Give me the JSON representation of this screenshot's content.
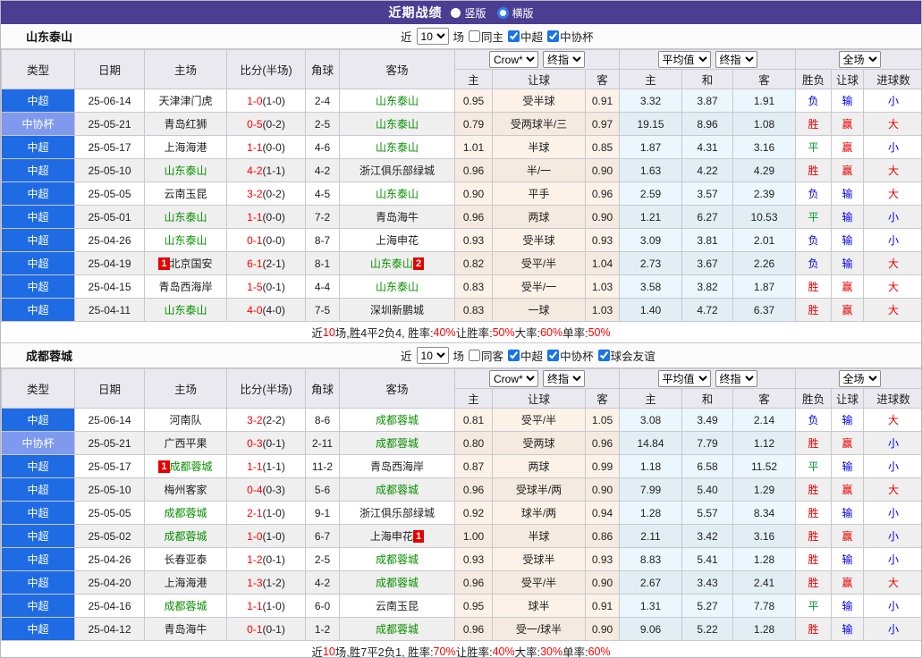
{
  "colors": {
    "header_purple": "#4b3e92",
    "type_csl_blue": "#1e6be4",
    "type_cup_blue": "#7e99ee",
    "team_green": "#089000",
    "score_red": "#ff0000",
    "win_red": "#e60000",
    "lose_blue": "#0000e6",
    "draw_green": "#009933"
  },
  "result_colors": {
    "胜": "#e60000",
    "平": "#009933",
    "负": "#0000e6",
    "赢": "#e60000",
    "输": "#0000e6",
    "大": "#e60000",
    "小": "#0000e6"
  },
  "type_colors": {
    "中超": "#1e6be4",
    "中协杯": "#7e99ee"
  },
  "topbar": {
    "title": "近期战绩",
    "radios": [
      {
        "label": "竖版",
        "selected": false
      },
      {
        "label": "横版",
        "selected": true
      }
    ]
  },
  "columns": {
    "main": [
      "类型",
      "日期",
      "主场",
      "比分(半场)",
      "角球",
      "客场"
    ],
    "sub": [
      "主",
      "让球",
      "客",
      "主",
      "和",
      "客",
      "胜负",
      "让球",
      "进球数"
    ]
  },
  "header_selects": {
    "crow": "Crow*",
    "crow_final": "终指",
    "avg": "平均值",
    "avg_final": "终指",
    "fullmatch": "全场"
  },
  "sections": [
    {
      "team": "山东泰山",
      "filter": {
        "near_label": "近",
        "count_value": "10",
        "games_label": "场",
        "checkboxes": [
          {
            "label": "同主",
            "checked": false
          },
          {
            "label": "中超",
            "checked": true
          },
          {
            "label": "中协杯",
            "checked": true
          }
        ]
      },
      "rows": [
        {
          "type": "中超",
          "date": "25-06-14",
          "home": {
            "name": "天津津门虎",
            "green": false
          },
          "ft": "1-0",
          "ht": "(1-0)",
          "corner": "2-4",
          "away": {
            "name": "山东泰山",
            "green": true
          },
          "odds": [
            "0.95",
            "受半球",
            "0.91"
          ],
          "avg": [
            "3.32",
            "3.87",
            "1.91"
          ],
          "res": [
            "负",
            "输",
            "小"
          ]
        },
        {
          "type": "中协杯",
          "date": "25-05-21",
          "home": {
            "name": "青岛红狮",
            "green": false
          },
          "ft": "0-5",
          "ht": "(0-2)",
          "corner": "2-5",
          "away": {
            "name": "山东泰山",
            "green": true
          },
          "odds": [
            "0.79",
            "受两球半/三",
            "0.97"
          ],
          "avg": [
            "19.15",
            "8.96",
            "1.08"
          ],
          "res": [
            "胜",
            "赢",
            "大"
          ]
        },
        {
          "type": "中超",
          "date": "25-05-17",
          "home": {
            "name": "上海海港",
            "green": false
          },
          "ft": "1-1",
          "ht": "(0-0)",
          "corner": "4-6",
          "away": {
            "name": "山东泰山",
            "green": true
          },
          "odds": [
            "1.01",
            "半球",
            "0.85"
          ],
          "avg": [
            "1.87",
            "4.31",
            "3.16"
          ],
          "res": [
            "平",
            "赢",
            "小"
          ]
        },
        {
          "type": "中超",
          "date": "25-05-10",
          "home": {
            "name": "山东泰山",
            "green": true
          },
          "ft": "4-2",
          "ht": "(1-1)",
          "corner": "4-2",
          "away": {
            "name": "浙江俱乐部绿城",
            "green": false
          },
          "odds": [
            "0.96",
            "半/一",
            "0.90"
          ],
          "avg": [
            "1.63",
            "4.22",
            "4.29"
          ],
          "res": [
            "胜",
            "赢",
            "大"
          ]
        },
        {
          "type": "中超",
          "date": "25-05-05",
          "home": {
            "name": "云南玉昆",
            "green": false
          },
          "ft": "3-2",
          "ht": "(0-2)",
          "corner": "4-5",
          "away": {
            "name": "山东泰山",
            "green": true
          },
          "odds": [
            "0.90",
            "平手",
            "0.96"
          ],
          "avg": [
            "2.59",
            "3.57",
            "2.39"
          ],
          "res": [
            "负",
            "输",
            "大"
          ]
        },
        {
          "type": "中超",
          "date": "25-05-01",
          "home": {
            "name": "山东泰山",
            "green": true
          },
          "ft": "1-1",
          "ht": "(0-0)",
          "corner": "7-2",
          "away": {
            "name": "青岛海牛",
            "green": false
          },
          "odds": [
            "0.96",
            "两球",
            "0.90"
          ],
          "avg": [
            "1.21",
            "6.27",
            "10.53"
          ],
          "res": [
            "平",
            "输",
            "小"
          ]
        },
        {
          "type": "中超",
          "date": "25-04-26",
          "home": {
            "name": "山东泰山",
            "green": true
          },
          "ft": "0-1",
          "ht": "(0-0)",
          "corner": "8-7",
          "away": {
            "name": "上海申花",
            "green": false
          },
          "odds": [
            "0.93",
            "受半球",
            "0.93"
          ],
          "avg": [
            "3.09",
            "3.81",
            "2.01"
          ],
          "res": [
            "负",
            "输",
            "小"
          ]
        },
        {
          "type": "中超",
          "date": "25-04-19",
          "home": {
            "name": "北京国安",
            "green": false,
            "badge_before": "1"
          },
          "ft": "6-1",
          "ht": "(2-1)",
          "corner": "8-1",
          "away": {
            "name": "山东泰山",
            "green": true,
            "badge_after": "2"
          },
          "odds": [
            "0.82",
            "受平/半",
            "1.04"
          ],
          "avg": [
            "2.73",
            "3.67",
            "2.26"
          ],
          "res": [
            "负",
            "输",
            "大"
          ]
        },
        {
          "type": "中超",
          "date": "25-04-15",
          "home": {
            "name": "青岛西海岸",
            "green": false
          },
          "ft": "1-5",
          "ht": "(0-1)",
          "corner": "4-4",
          "away": {
            "name": "山东泰山",
            "green": true
          },
          "odds": [
            "0.83",
            "受半/一",
            "1.03"
          ],
          "avg": [
            "3.58",
            "3.82",
            "1.87"
          ],
          "res": [
            "胜",
            "赢",
            "大"
          ]
        },
        {
          "type": "中超",
          "date": "25-04-11",
          "home": {
            "name": "山东泰山",
            "green": true
          },
          "ft": "4-0",
          "ht": "(4-0)",
          "corner": "7-5",
          "away": {
            "name": "深圳新鹏城",
            "green": false
          },
          "odds": [
            "0.83",
            "一球",
            "1.03"
          ],
          "avg": [
            "1.40",
            "4.72",
            "6.37"
          ],
          "res": [
            "胜",
            "赢",
            "大"
          ]
        }
      ],
      "summary": [
        {
          "text": "近",
          "color": "k"
        },
        {
          "text": "10",
          "color": "r"
        },
        {
          "text": "场,胜4平2负4, 胜率:",
          "color": "k"
        },
        {
          "text": "40%",
          "color": "r"
        },
        {
          "text": " 让胜率:",
          "color": "k"
        },
        {
          "text": "50%",
          "color": "r"
        },
        {
          "text": " 大率:",
          "color": "k"
        },
        {
          "text": "60%",
          "color": "r"
        },
        {
          "text": " 单率:",
          "color": "k"
        },
        {
          "text": "50%",
          "color": "r"
        }
      ]
    },
    {
      "team": "成都蓉城",
      "filter": {
        "near_label": "近",
        "count_value": "10",
        "games_label": "场",
        "checkboxes": [
          {
            "label": "同客",
            "checked": false
          },
          {
            "label": "中超",
            "checked": true
          },
          {
            "label": "中协杯",
            "checked": true
          },
          {
            "label": "球会友谊",
            "checked": true
          }
        ]
      },
      "rows": [
        {
          "type": "中超",
          "date": "25-06-14",
          "home": {
            "name": "河南队",
            "green": false
          },
          "ft": "3-2",
          "ht": "(2-2)",
          "corner": "8-6",
          "away": {
            "name": "成都蓉城",
            "green": true
          },
          "odds": [
            "0.81",
            "受平/半",
            "1.05"
          ],
          "avg": [
            "3.08",
            "3.49",
            "2.14"
          ],
          "res": [
            "负",
            "输",
            "大"
          ]
        },
        {
          "type": "中协杯",
          "date": "25-05-21",
          "home": {
            "name": "广西平果",
            "green": false
          },
          "ft": "0-3",
          "ht": "(0-1)",
          "corner": "2-11",
          "away": {
            "name": "成都蓉城",
            "green": true
          },
          "odds": [
            "0.80",
            "受两球",
            "0.96"
          ],
          "avg": [
            "14.84",
            "7.79",
            "1.12"
          ],
          "res": [
            "胜",
            "赢",
            "小"
          ]
        },
        {
          "type": "中超",
          "date": "25-05-17",
          "home": {
            "name": "成都蓉城",
            "green": true,
            "badge_before": "1"
          },
          "ft": "1-1",
          "ht": "(1-1)",
          "corner": "11-2",
          "away": {
            "name": "青岛西海岸",
            "green": false
          },
          "odds": [
            "0.87",
            "两球",
            "0.99"
          ],
          "avg": [
            "1.18",
            "6.58",
            "11.52"
          ],
          "res": [
            "平",
            "输",
            "小"
          ]
        },
        {
          "type": "中超",
          "date": "25-05-10",
          "home": {
            "name": "梅州客家",
            "green": false
          },
          "ft": "0-4",
          "ht": "(0-3)",
          "corner": "5-6",
          "away": {
            "name": "成都蓉城",
            "green": true
          },
          "odds": [
            "0.96",
            "受球半/两",
            "0.90"
          ],
          "avg": [
            "7.99",
            "5.40",
            "1.29"
          ],
          "res": [
            "胜",
            "赢",
            "大"
          ]
        },
        {
          "type": "中超",
          "date": "25-05-05",
          "home": {
            "name": "成都蓉城",
            "green": true
          },
          "ft": "2-1",
          "ht": "(1-0)",
          "corner": "9-1",
          "away": {
            "name": "浙江俱乐部绿城",
            "green": false
          },
          "odds": [
            "0.92",
            "球半/两",
            "0.94"
          ],
          "avg": [
            "1.28",
            "5.57",
            "8.34"
          ],
          "res": [
            "胜",
            "输",
            "小"
          ]
        },
        {
          "type": "中超",
          "date": "25-05-02",
          "home": {
            "name": "成都蓉城",
            "green": true
          },
          "ft": "1-0",
          "ht": "(1-0)",
          "corner": "6-7",
          "away": {
            "name": "上海申花",
            "green": false,
            "badge_after": "1"
          },
          "odds": [
            "1.00",
            "半球",
            "0.86"
          ],
          "avg": [
            "2.11",
            "3.42",
            "3.16"
          ],
          "res": [
            "胜",
            "赢",
            "小"
          ]
        },
        {
          "type": "中超",
          "date": "25-04-26",
          "home": {
            "name": "长春亚泰",
            "green": false
          },
          "ft": "1-2",
          "ht": "(0-1)",
          "corner": "2-5",
          "away": {
            "name": "成都蓉城",
            "green": true
          },
          "odds": [
            "0.93",
            "受球半",
            "0.93"
          ],
          "avg": [
            "8.83",
            "5.41",
            "1.28"
          ],
          "res": [
            "胜",
            "输",
            "小"
          ]
        },
        {
          "type": "中超",
          "date": "25-04-20",
          "home": {
            "name": "上海海港",
            "green": false
          },
          "ft": "1-3",
          "ht": "(1-2)",
          "corner": "4-2",
          "away": {
            "name": "成都蓉城",
            "green": true
          },
          "odds": [
            "0.96",
            "受平/半",
            "0.90"
          ],
          "avg": [
            "2.67",
            "3.43",
            "2.41"
          ],
          "res": [
            "胜",
            "赢",
            "大"
          ]
        },
        {
          "type": "中超",
          "date": "25-04-16",
          "home": {
            "name": "成都蓉城",
            "green": true
          },
          "ft": "1-1",
          "ht": "(1-0)",
          "corner": "6-0",
          "away": {
            "name": "云南玉昆",
            "green": false
          },
          "odds": [
            "0.95",
            "球半",
            "0.91"
          ],
          "avg": [
            "1.31",
            "5.27",
            "7.78"
          ],
          "res": [
            "平",
            "输",
            "小"
          ]
        },
        {
          "type": "中超",
          "date": "25-04-12",
          "home": {
            "name": "青岛海牛",
            "green": false
          },
          "ft": "0-1",
          "ht": "(0-1)",
          "corner": "1-2",
          "away": {
            "name": "成都蓉城",
            "green": true
          },
          "odds": [
            "0.96",
            "受一/球半",
            "0.90"
          ],
          "avg": [
            "9.06",
            "5.22",
            "1.28"
          ],
          "res": [
            "胜",
            "输",
            "小"
          ]
        }
      ],
      "summary": [
        {
          "text": "近",
          "color": "k"
        },
        {
          "text": "10",
          "color": "r"
        },
        {
          "text": "场,胜7平2负1, 胜率:",
          "color": "k"
        },
        {
          "text": "70%",
          "color": "r"
        },
        {
          "text": " 让胜率:",
          "color": "k"
        },
        {
          "text": "40%",
          "color": "r"
        },
        {
          "text": " 大率:",
          "color": "k"
        },
        {
          "text": "30%",
          "color": "r"
        },
        {
          "text": " 单率:",
          "color": "k"
        },
        {
          "text": "60%",
          "color": "r"
        }
      ]
    }
  ]
}
